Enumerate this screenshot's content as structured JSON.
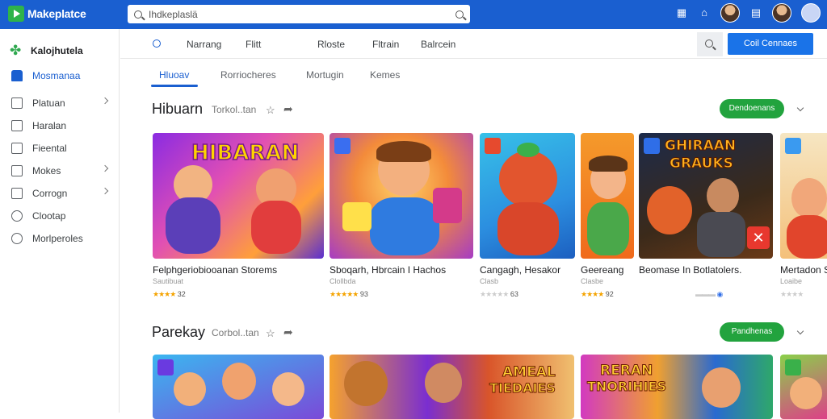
{
  "app": {
    "logo_text": "Makeplatce"
  },
  "search": {
    "value": "Ihdkeplaslä"
  },
  "sidebar": {
    "brand": "Kalojhutela",
    "items": [
      {
        "label": "Mosmanaa",
        "icon": "home-icon",
        "active": true
      },
      {
        "label": "Platuan",
        "icon": "grid-icon",
        "chevron": true
      },
      {
        "label": "Haralan",
        "icon": "chart-icon"
      },
      {
        "label": "Fieental",
        "icon": "doc-icon"
      },
      {
        "label": "Mokes",
        "icon": "mail-icon",
        "chevron": true
      },
      {
        "label": "Corrogn",
        "icon": "calendar-icon",
        "chevron": true
      },
      {
        "label": "Clootap",
        "icon": "circle-icon"
      },
      {
        "label": "Morlperoles",
        "icon": "settings-icon"
      }
    ]
  },
  "subnav": {
    "links": [
      "Narrang",
      "Flitt",
      "Rloste",
      "Fltrain",
      "Balrcein"
    ],
    "cta_label": "Coil  Cennaes"
  },
  "tabs": [
    "Hluoav",
    "Rorriocheres",
    "Mortugin",
    "Kemes"
  ],
  "sections": [
    {
      "title": "Hibuarn",
      "subtitle": "Torkol..tan",
      "action_label": "Dendoenans",
      "cards": [
        {
          "title": "Felphgeriobiooanan Storems",
          "sub": "Sautibuat",
          "rating": "32"
        },
        {
          "title": "Sboqarh, Hbrcain I Hachos",
          "sub": "Clollbda",
          "rating": "93"
        },
        {
          "title": "Cangagh, Hesakor",
          "sub": "Clasb",
          "rating": "63"
        },
        {
          "title": "Geereang",
          "sub": "Clasbe",
          "rating": "92"
        },
        {
          "title": "Beomase In Botlatolers.",
          "sub": "",
          "rating": ""
        },
        {
          "title": "Mertadon S",
          "sub": "Loaibe",
          "rating": ""
        }
      ],
      "thumb_texts": {
        "t1": "HIBARAN",
        "t2": "GHIRAAN",
        "t3": "GRAUKS"
      }
    },
    {
      "title": "Parekay",
      "subtitle": "Corbol..tan",
      "action_label": "Pandhenas",
      "thumb_texts": {
        "t1": "AMEAL",
        "t2": "TIEDAIES",
        "t3": "RERAN",
        "t4": "TNORIHIES"
      }
    }
  ],
  "colors": {
    "accent": "#1a5fd0",
    "green": "#22a33e",
    "cta": "#1a73e8"
  }
}
